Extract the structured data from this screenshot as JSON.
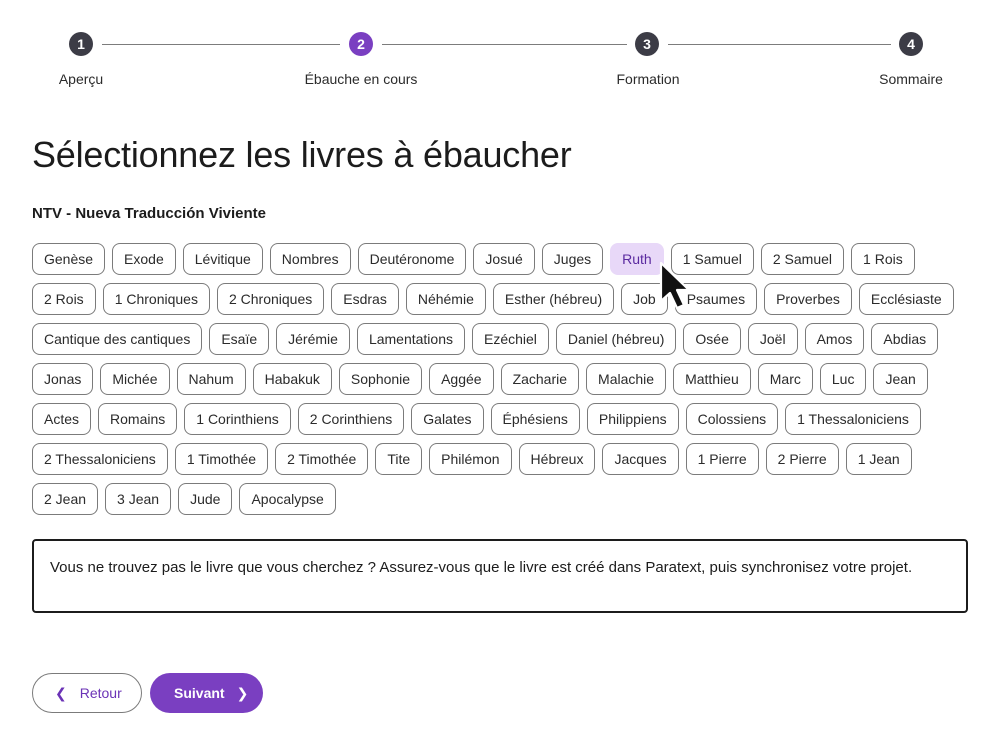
{
  "stepper": {
    "steps": [
      {
        "number": "1",
        "label": "Aperçu"
      },
      {
        "number": "2",
        "label": "Ébauche en cours"
      },
      {
        "number": "3",
        "label": "Formation"
      },
      {
        "number": "4",
        "label": "Sommaire"
      }
    ],
    "active_step": 2
  },
  "page_title": "Sélectionnez les livres à ébaucher",
  "project_name": "NTV - Nueva Traducción Viviente",
  "books": [
    "Genèse",
    "Exode",
    "Lévitique",
    "Nombres",
    "Deutéronome",
    "Josué",
    "Juges",
    "Ruth",
    "1 Samuel",
    "2 Samuel",
    "1 Rois",
    "2 Rois",
    "1 Chroniques",
    "2 Chroniques",
    "Esdras",
    "Néhémie",
    "Esther (hébreu)",
    "Job",
    "Psaumes",
    "Proverbes",
    "Ecclésiaste",
    "Cantique des cantiques",
    "Esaïe",
    "Jérémie",
    "Lamentations",
    "Ezéchiel",
    "Daniel (hébreu)",
    "Osée",
    "Joël",
    "Amos",
    "Abdias",
    "Jonas",
    "Michée",
    "Nahum",
    "Habakuk",
    "Sophonie",
    "Aggée",
    "Zacharie",
    "Malachie",
    "Matthieu",
    "Marc",
    "Luc",
    "Jean",
    "Actes",
    "Romains",
    "1 Corinthiens",
    "2 Corinthiens",
    "Galates",
    "Éphésiens",
    "Philippiens",
    "Colossiens",
    "1 Thessaloniciens",
    "2 Thessaloniciens",
    "1 Timothée",
    "2 Timothée",
    "Tite",
    "Philémon",
    "Hébreux",
    "Jacques",
    "1 Pierre",
    "2 Pierre",
    "1 Jean",
    "2 Jean",
    "3 Jean",
    "Jude",
    "Apocalypse"
  ],
  "selected_books": [
    "Ruth"
  ],
  "notice_text": "Vous ne trouvez pas le livre que vous cherchez ? Assurez-vous que le livre est créé dans Paratext, puis synchronisez votre projet.",
  "buttons": {
    "back_label": "Retour",
    "next_label": "Suivant"
  },
  "colors": {
    "accent": "#7a3fc1",
    "chip_selected_bg": "#e8d8f8",
    "step_inactive": "#3c3c46"
  }
}
